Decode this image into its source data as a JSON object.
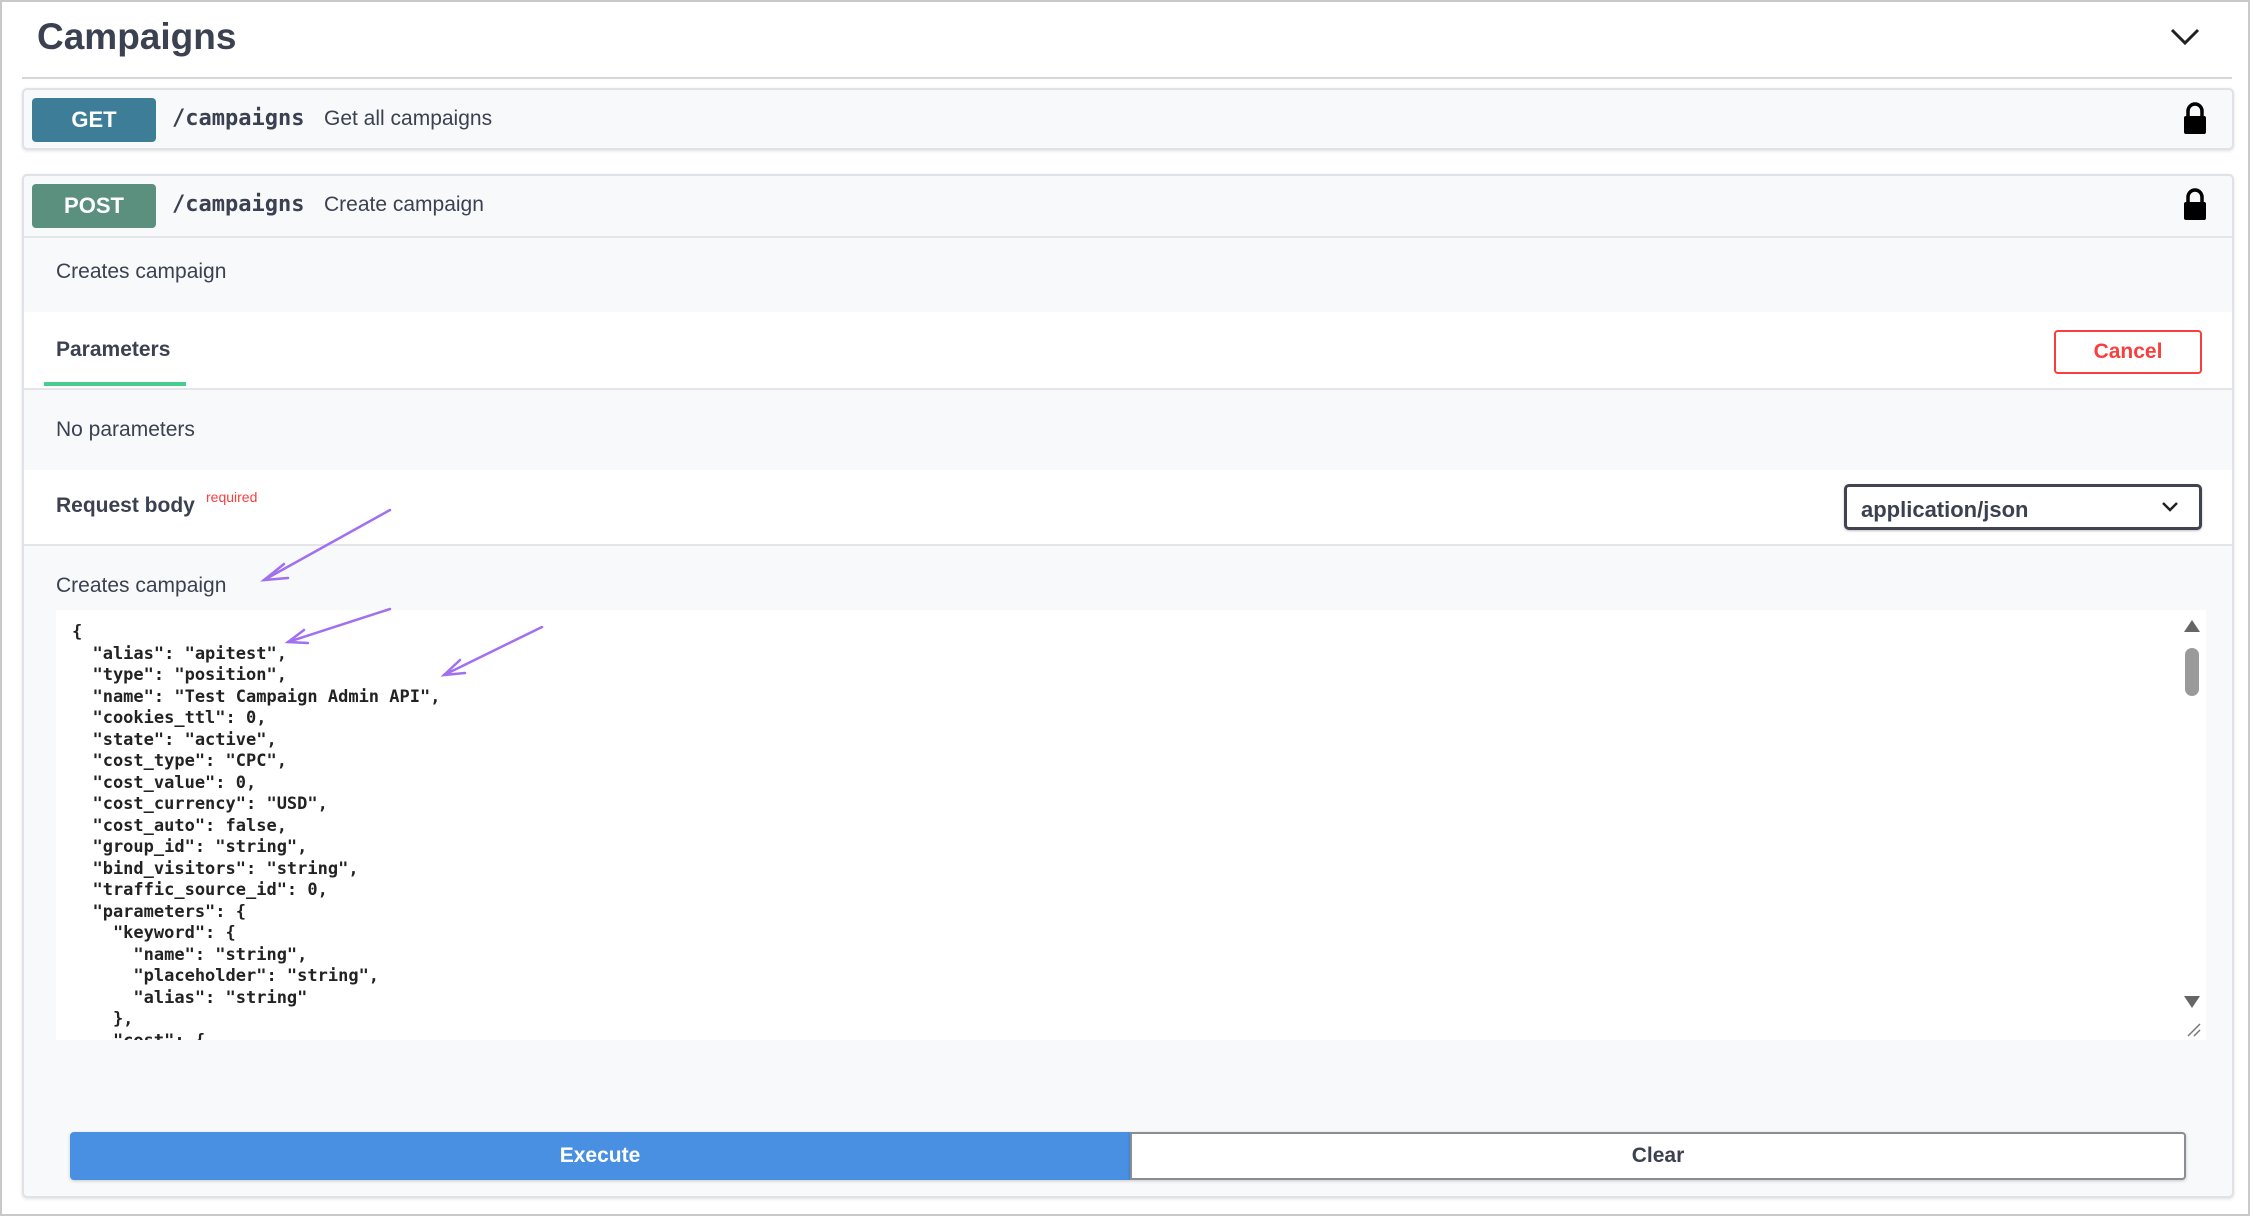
{
  "section": {
    "title": "Campaigns",
    "collapse_icon": "chevron-down-icon"
  },
  "operations": {
    "get": {
      "method": "GET",
      "path": "/campaigns",
      "summary": "Get all campaigns",
      "lock_icon": "lock-icon"
    },
    "post": {
      "method": "POST",
      "path": "/campaigns",
      "summary": "Create campaign",
      "description": "Creates campaign",
      "parameters_tab": "Parameters",
      "cancel_label": "Cancel",
      "no_parameters": "No parameters",
      "request_body_label": "Request body",
      "required_label": "required",
      "content_type": "application/json",
      "body_description": "Creates campaign",
      "body_code": "{\n  \"alias\": \"apitest\",\n  \"type\": \"position\",\n  \"name\": \"Test Campaign Admin API\",\n  \"cookies_ttl\": 0,\n  \"state\": \"active\",\n  \"cost_type\": \"CPC\",\n  \"cost_value\": 0,\n  \"cost_currency\": \"USD\",\n  \"cost_auto\": false,\n  \"group_id\": \"string\",\n  \"bind_visitors\": \"string\",\n  \"traffic_source_id\": 0,\n  \"parameters\": {\n    \"keyword\": {\n      \"name\": \"string\",\n      \"placeholder\": \"string\",\n      \"alias\": \"string\"\n    },\n    \"cost\": {",
      "execute_label": "Execute",
      "clear_label": "Clear"
    }
  },
  "colors": {
    "get_method": "#3d7d97",
    "post_method": "#5b8f7e",
    "cancel": "#f93e3e",
    "tab_underline": "#49cc90",
    "execute": "#4990e2",
    "annotation_arrow": "#a070f0"
  }
}
